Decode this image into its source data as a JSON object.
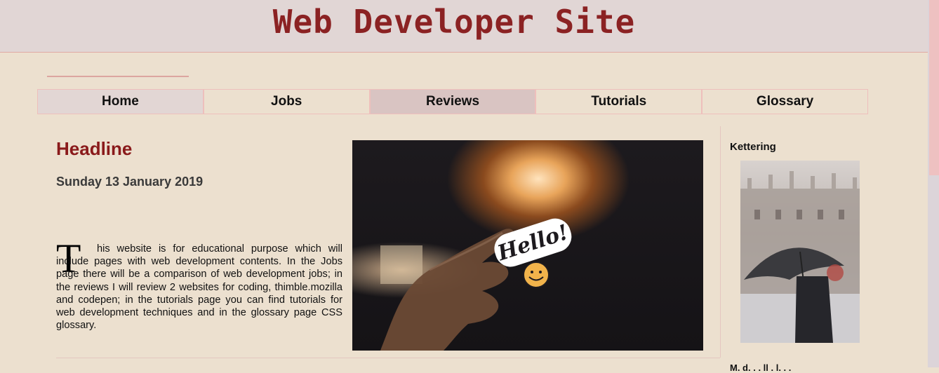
{
  "site": {
    "title": "Web Developer Site"
  },
  "nav": {
    "items": [
      {
        "label": "Home"
      },
      {
        "label": "Jobs"
      },
      {
        "label": "Reviews"
      },
      {
        "label": "Tutorials"
      },
      {
        "label": "Glossary"
      }
    ]
  },
  "article": {
    "headline": "Headline",
    "date": "Sunday 13 January 2019",
    "dropcap": "T",
    "body": "his website is for educational purpose which will include pages with web development contents. In the Jobs page there will be a comparison of web development jobs; in the reviews I will review 2 websites for coding, thimble.mozilla and codepen; in the tutorials page you can find tutorials for web development techniques and in the glossary page CSS glossary.",
    "image_sticker_text": "Hello!"
  },
  "aside": {
    "title": "Kettering",
    "next_label": "M. d. . . ll . l. . ."
  },
  "colors": {
    "accent": "#8b2223",
    "background": "#ece0cf",
    "header_bg": "#e1d6d5",
    "border": "#eebfbc"
  }
}
